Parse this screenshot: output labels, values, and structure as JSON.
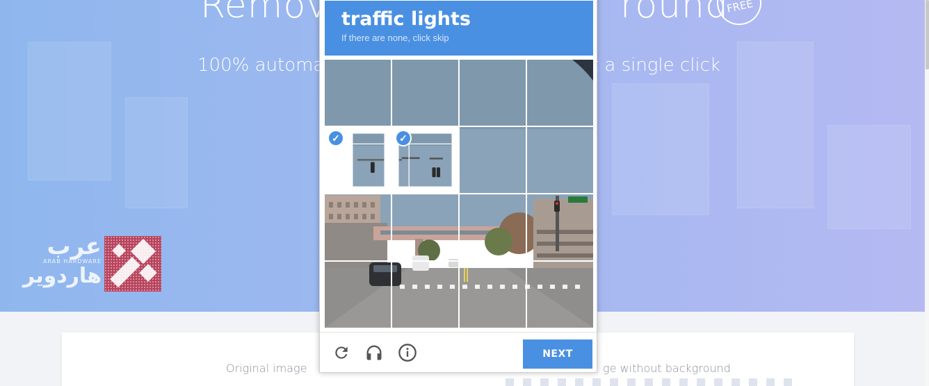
{
  "hero": {
    "title_left": "Remov",
    "title_right": "round",
    "free_badge": "FREE",
    "subtitle_left": "100% automa",
    "subtitle_right": "t a single click"
  },
  "watermark": {
    "arabic_top": "عرب",
    "english": "ARAB HARDWARE",
    "arabic_bottom": "هاردوير"
  },
  "panel": {
    "original_label": "Original image",
    "without_label": "ge without background"
  },
  "captcha": {
    "target": "traffic lights",
    "hint": "If there are none, click skip",
    "tiles": [
      {
        "row": 0,
        "col": 0,
        "selected": false
      },
      {
        "row": 0,
        "col": 1,
        "selected": false
      },
      {
        "row": 0,
        "col": 2,
        "selected": false
      },
      {
        "row": 0,
        "col": 3,
        "selected": false
      },
      {
        "row": 1,
        "col": 0,
        "selected": true
      },
      {
        "row": 1,
        "col": 1,
        "selected": true
      },
      {
        "row": 1,
        "col": 2,
        "selected": false
      },
      {
        "row": 1,
        "col": 3,
        "selected": false
      },
      {
        "row": 2,
        "col": 0,
        "selected": false
      },
      {
        "row": 2,
        "col": 1,
        "selected": false
      },
      {
        "row": 2,
        "col": 2,
        "selected": false
      },
      {
        "row": 2,
        "col": 3,
        "selected": false
      },
      {
        "row": 3,
        "col": 0,
        "selected": false
      },
      {
        "row": 3,
        "col": 1,
        "selected": false
      },
      {
        "row": 3,
        "col": 2,
        "selected": false
      },
      {
        "row": 3,
        "col": 3,
        "selected": false
      }
    ],
    "footer": {
      "reload_icon": "reload-icon",
      "audio_icon": "headphones-icon",
      "info_icon": "info-icon",
      "next_label": "NEXT"
    }
  },
  "colors": {
    "accent": "#4a90e2",
    "hero_start": "#8fb7ee",
    "hero_end": "#b5b9f2",
    "logo_pink": "#b8435c"
  }
}
